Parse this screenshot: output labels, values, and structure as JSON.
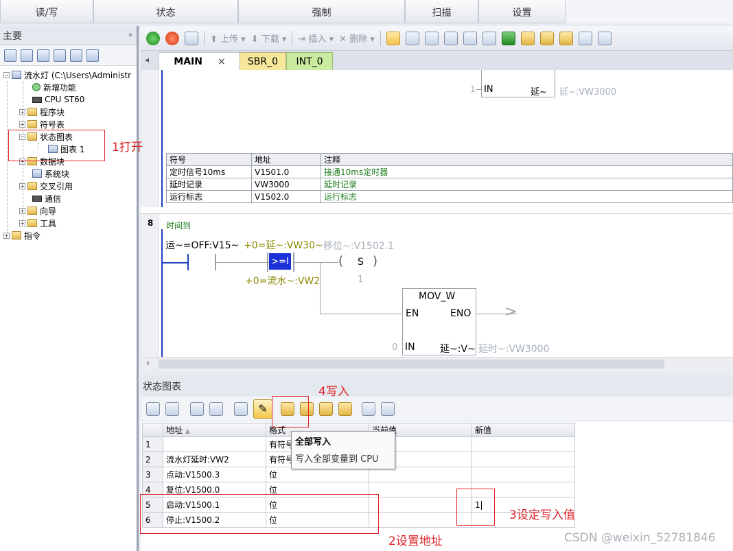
{
  "ribbon": {
    "tabs": [
      "读/写",
      "状态",
      "强制",
      "扫描",
      "设置"
    ]
  },
  "left_panel": {
    "title": "主要",
    "pin": "ᵖ",
    "tree": {
      "root": "流水灯 (C:\\Users\\Administr",
      "items": [
        "新增功能",
        "CPU ST60",
        "程序块",
        "符号表",
        "状态图表",
        "图表 1",
        "数据块",
        "系统块",
        "交叉引用",
        "通信",
        "向导",
        "工具"
      ],
      "instructions": "指令"
    }
  },
  "toolbar": {
    "upload": "上传",
    "download": "下载",
    "insert": "插入",
    "delete": "删除"
  },
  "doc_tabs": {
    "main": "MAIN",
    "close": "×",
    "sbr": "SBR_0",
    "int": "INT_0"
  },
  "editor": {
    "top_block": {
      "in_val": "1",
      "in_label": "IN",
      "out_label": "延~",
      "out_ref": "延~:VW3000"
    },
    "symbol_table": {
      "headers": [
        "符号",
        "地址",
        "注释"
      ],
      "rows": [
        [
          "定时信号10ms",
          "V1501.0",
          "接通10ms定时器"
        ],
        [
          "延时记录",
          "VW3000",
          "延时记录"
        ],
        [
          "运行标志",
          "V1502.0",
          "运行标志"
        ]
      ]
    },
    "network": {
      "number": "8",
      "comment": "时间到",
      "contact_left": "运~=OFF:V15~",
      "compare_top": "+0=延~:VW30~",
      "coil_ref": "移位~:V1502.1",
      "compare_op": ">=I",
      "coil_symbol": "S",
      "coil_count": "1",
      "compare_bottom": "+0=流水~:VW2",
      "mov": {
        "title": "MOV_W",
        "en": "EN",
        "eno": "ENO",
        "in": "IN",
        "in_val": "0",
        "out": "延~:V~",
        "out_ref": "延时~:VW3000"
      }
    }
  },
  "status_chart": {
    "title": "状态图表",
    "headers": [
      "地址",
      "格式",
      "当前值",
      "新值"
    ],
    "rows": [
      {
        "n": "1",
        "addr": "",
        "fmt": "有符号",
        "cur": "",
        "new": ""
      },
      {
        "n": "2",
        "addr": "流水灯延时:VW2",
        "fmt": "有符号",
        "cur": "",
        "new": ""
      },
      {
        "n": "3",
        "addr": "点动:V1500.3",
        "fmt": "位",
        "cur": "",
        "new": ""
      },
      {
        "n": "4",
        "addr": "复位:V1500.0",
        "fmt": "位",
        "cur": "",
        "new": ""
      },
      {
        "n": "5",
        "addr": "启动:V1500.1",
        "fmt": "位",
        "cur": "",
        "new": "1"
      },
      {
        "n": "6",
        "addr": "停止:V1500.2",
        "fmt": "位",
        "cur": "",
        "new": ""
      }
    ],
    "tooltip": {
      "title": "全部写入",
      "desc": "写入全部变量到 CPU"
    }
  },
  "annotations": {
    "a1": "1打开",
    "a2": "2设置地址",
    "a3": "3设定写入值",
    "a4": "4写入"
  },
  "watermark": "CSDN @weixin_52781846"
}
